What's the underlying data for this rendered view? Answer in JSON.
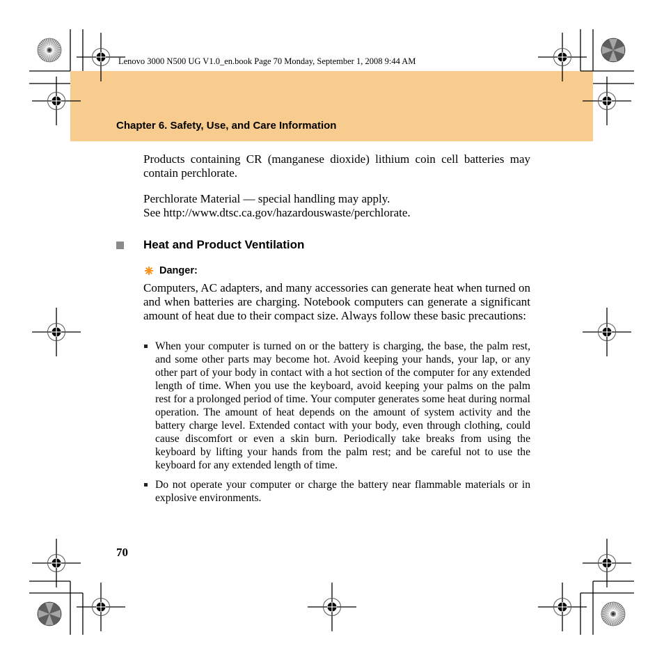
{
  "header": {
    "print_info": "Lenovo 3000 N500 UG V1.0_en.book  Page 70  Monday, September 1, 2008  9:44 AM"
  },
  "chapter": {
    "title": "Chapter 6. Safety, Use, and Care Information",
    "band_color": "#f8cb8e"
  },
  "intro": {
    "paragraph1": "Products containing CR (manganese dioxide) lithium coin cell batteries may contain perchlorate.",
    "paragraph2_line1": "Perchlorate Material — special handling may apply.",
    "paragraph2_line2": "See http://www.dtsc.ca.gov/hazardouswaste/perchlorate."
  },
  "section": {
    "marker_icon": "gray-square-bullet",
    "title": "Heat and Product Ventilation",
    "danger": {
      "icon": "danger-burst-icon",
      "icon_color": "#f7941d",
      "label": "Danger:"
    },
    "body": "Computers, AC adapters, and many accessories can generate heat when turned on and when batteries are charging. Notebook computers can generate a significant amount of heat due to their compact size. Always follow these basic precautions:",
    "bullets": [
      "When your computer is turned on or the battery is charging, the base, the palm rest, and some other parts may become hot. Avoid keeping your hands, your lap, or any other part of your body in contact with a hot section of the computer for any extended length of time. When you use the keyboard, avoid keeping your palms on the palm rest for a prolonged period of time. Your computer generates some heat during normal operation. The amount of heat depends on the amount of system activity and the battery charge level. Extended contact with your body, even through clothing, could cause discomfort or even a skin burn. Periodically take breaks from using the keyboard by lifting your hands from the palm rest; and be careful not to use the keyboard for any extended length of time.",
      "Do not operate your computer or charge the battery near flammable materials or in explosive environments."
    ]
  },
  "footer": {
    "page_number": "70"
  },
  "print_marks": {
    "registration_mark_icon": "registration-crosshair-icon",
    "color_wheel_icon": "color-bar-wheel-icon",
    "crop_mark_icon": "crop-mark-icon"
  }
}
